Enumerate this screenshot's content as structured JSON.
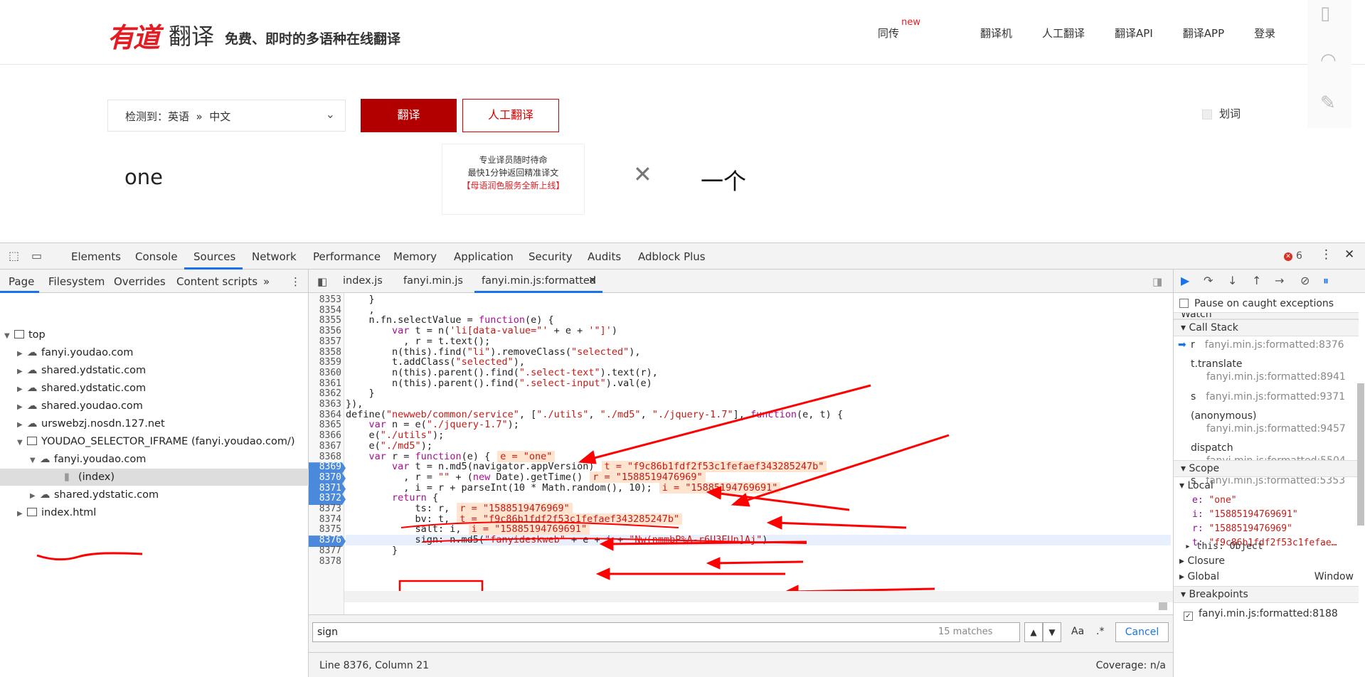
{
  "site": {
    "logo_main": "有道",
    "logo_sub": "翻译",
    "slogan": "免费、即时的多语种在线翻译",
    "nav": [
      {
        "label": "同传",
        "badge": "new"
      },
      {
        "label": "翻译机"
      },
      {
        "label": "人工翻译"
      },
      {
        "label": "翻译API"
      },
      {
        "label": "翻译APP"
      },
      {
        "label": "登录"
      }
    ],
    "lang_select": "检测到：英语  »  中文",
    "translate_button": "翻译",
    "human_button": "人工翻译",
    "tip_line1": "专业译员随时待命",
    "tip_line2": "最快1分钟返回精准译文",
    "tip_line3": "【母语润色服务全新上线】",
    "huaci": "划词",
    "source_text": "one",
    "target_text": "一个"
  },
  "devtools": {
    "tabs": [
      "Elements",
      "Console",
      "Sources",
      "Network",
      "Performance",
      "Memory",
      "Application",
      "Security",
      "Audits",
      "Adblock Plus"
    ],
    "active_tab": "Sources",
    "error_count": "6",
    "nav_tabs": [
      "Page",
      "Filesystem",
      "Overrides",
      "Content scripts"
    ],
    "tree": [
      {
        "label": "top",
        "type": "frame",
        "level": 0,
        "open": true
      },
      {
        "label": "fanyi.youdao.com",
        "type": "cloud",
        "level": 1
      },
      {
        "label": "shared.ydstatic.com",
        "type": "cloud",
        "level": 1
      },
      {
        "label": "shared.ydstatic.com",
        "type": "cloud",
        "level": 1
      },
      {
        "label": "shared.youdao.com",
        "type": "cloud",
        "level": 1
      },
      {
        "label": "urswebzj.nosdn.127.net",
        "type": "cloud",
        "level": 1
      },
      {
        "label": "YOUDAO_SELECTOR_IFRAME (fanyi.youdao.com/)",
        "type": "frame",
        "level": 1,
        "open": true
      },
      {
        "label": "fanyi.youdao.com",
        "type": "cloud",
        "level": 2,
        "open": true
      },
      {
        "label": "(index)",
        "type": "file",
        "level": 3,
        "selected": true
      },
      {
        "label": "shared.ydstatic.com",
        "type": "cloud",
        "level": 2
      },
      {
        "label": "index.html",
        "type": "frame",
        "level": 1
      }
    ],
    "editor_tabs": [
      "index.js",
      "fanyi.min.js",
      "fanyi.min.js:formatted"
    ],
    "code_lines": [
      {
        "n": "8353",
        "t": "    }"
      },
      {
        "n": "8354",
        "t": "    ,"
      },
      {
        "n": "8355",
        "t": "    n.fn.selectValue = function(e) {"
      },
      {
        "n": "8356",
        "t": "        var t = n('li[data-value=\"' + e + '\"]')"
      },
      {
        "n": "8357",
        "t": "          , r = t.text();"
      },
      {
        "n": "8358",
        "t": "        n(this).find(\"li\").removeClass(\"selected\"),"
      },
      {
        "n": "8359",
        "t": "        t.addClass(\"selected\"),"
      },
      {
        "n": "8360",
        "t": "        n(this).parent().find(\".select-text\").text(r),"
      },
      {
        "n": "8361",
        "t": "        n(this).parent().find(\".select-input\").val(e)"
      },
      {
        "n": "8362",
        "t": "    }"
      },
      {
        "n": "8363",
        "t": "}),"
      },
      {
        "n": "8364",
        "t": "define(\"newweb/common/service\", [\"./utils\", \"./md5\", \"./jquery-1.7\"], function(e, t) {"
      },
      {
        "n": "8365",
        "t": "    var n = e(\"./jquery-1.7\");"
      },
      {
        "n": "8366",
        "t": "    e(\"./utils\");"
      },
      {
        "n": "8367",
        "t": "    e(\"./md5\");"
      },
      {
        "n": "8368",
        "t": "    var r = function(e) {",
        "v": "e = \"one\""
      },
      {
        "n": "8369",
        "t": "        var t = n.md5(navigator.appVersion)",
        "v": "t = \"f9c86b1fdf2f53c1fefaef343285247b\"",
        "bp": true
      },
      {
        "n": "8370",
        "t": "          , r = \"\" + (new Date).getTime()",
        "v": "r = \"1588519476969\"",
        "bp": true
      },
      {
        "n": "8371",
        "t": "          , i = r + parseInt(10 * Math.random(), 10);",
        "v": "i = \"15885194769691\"",
        "bp": true
      },
      {
        "n": "8372",
        "t": "        return {",
        "bp": true
      },
      {
        "n": "8373",
        "t": "            ts: r,",
        "v": "r = \"1588519476969\""
      },
      {
        "n": "8374",
        "t": "            bv: t,",
        "v": "t = \"f9c86b1fdf2f53c1fefaef343285247b\""
      },
      {
        "n": "8375",
        "t": "            salt: i,",
        "v": "i = \"15885194769691\""
      },
      {
        "n": "8376",
        "t": "            sign: n.md5(\"fanyideskweb\" + e + i + \"Nw(nmmbP%A-r6U3EUn]Aj\")",
        "bp": true,
        "current": true
      },
      {
        "n": "8377",
        "t": "        }"
      },
      {
        "n": "8378",
        "t": ""
      }
    ],
    "search_value": "sign",
    "match_count": "15 matches",
    "search_case": "Aa",
    "search_regex": ".*",
    "cancel_label": "Cancel",
    "status_position": "Line 8376, Column 21",
    "coverage": "Coverage: n/a",
    "pause_caught": "Pause on caught exceptions",
    "watch_label": "Watch",
    "callstack_label": "Call Stack",
    "callstack": [
      {
        "fn": "r",
        "loc": "fanyi.min.js:formatted:8376",
        "inline": true,
        "current": true
      },
      {
        "fn": "t.translate",
        "loc": "fanyi.min.js:formatted:8941"
      },
      {
        "fn": "s",
        "loc": "fanyi.min.js:formatted:9371",
        "inline": true
      },
      {
        "fn": "(anonymous)",
        "loc": "fanyi.min.js:formatted:9457"
      },
      {
        "fn": "dispatch",
        "loc": "fanyi.min.js:formatted:5504"
      },
      {
        "fn": "s",
        "loc": "fanyi.min.js:formatted:5353",
        "inline": true
      }
    ],
    "scope_label": "Scope",
    "local_label": "Local",
    "scope_vars": [
      {
        "k": "e",
        "v": "\"one\""
      },
      {
        "k": "i",
        "v": "\"15885194769691\""
      },
      {
        "k": "r",
        "v": "\"1588519476969\""
      },
      {
        "k": "t",
        "v": "\"f9c86b1fdf2f53c1fefae…"
      }
    ],
    "this_label": "this: Object",
    "closure_label": "Closure",
    "global_label": "Global",
    "global_value": "Window",
    "breakpoints_label": "Breakpoints",
    "breakpoint_item": "fanyi.min.js:formatted:8188"
  },
  "colors": {
    "brand_red": "#e31b23",
    "translate_btn": "#b20000",
    "devtools_blue": "#1a73e8",
    "breakpoint_blue": "#4a89dc",
    "annotation_red": "#ff0000"
  }
}
